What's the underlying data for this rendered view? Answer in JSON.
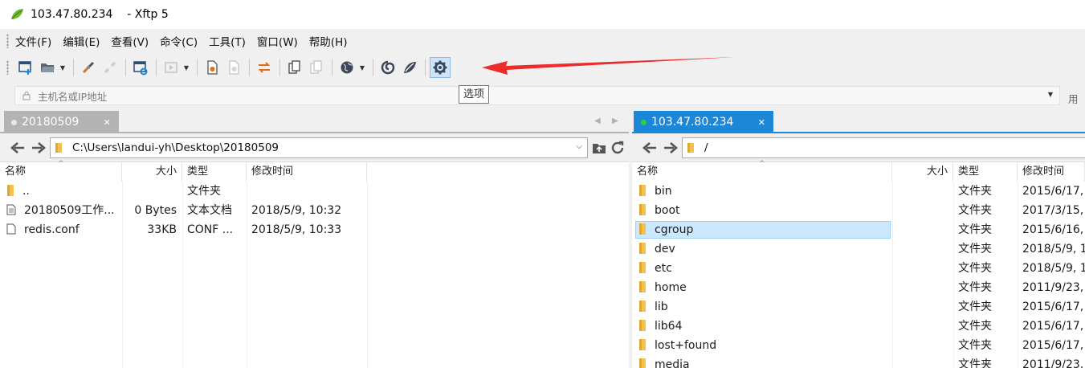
{
  "window": {
    "title": "103.47.80.234    - Xftp 5",
    "accent": "#1c86d8"
  },
  "menu": [
    "文件(F)",
    "编辑(E)",
    "查看(V)",
    "命令(C)",
    "工具(T)",
    "窗口(W)",
    "帮助(H)"
  ],
  "toolbar": {
    "buttons": [
      "new-session-icon",
      "open-folder-icon",
      "connect-icon",
      "disconnect-icon",
      "session-properties-icon",
      "transfer-icon",
      "new-file-icon",
      "new-file-disabled-icon",
      "sync-icon",
      "copy-icon",
      "paste-icon",
      "globe-icon",
      "xshell-icon",
      "xftp-icon",
      "gear-icon"
    ],
    "active": "gear-icon",
    "tooltip": "选项"
  },
  "address": {
    "host_placeholder": "主机名或IP地址",
    "user_label": "用户"
  },
  "left": {
    "tab_label": "20180509",
    "path": "C:\\Users\\landui-yh\\Desktop\\20180509",
    "columns": {
      "name": "名称",
      "size": "大小",
      "type": "类型",
      "modified": "修改时间"
    },
    "files": [
      {
        "name": "..",
        "size": "",
        "type": "文件夹",
        "modified": "",
        "icon": "folder-icon"
      },
      {
        "name": "20180509工作...",
        "size": "0 Bytes",
        "type": "文本文档",
        "modified": "2018/5/9, 10:32",
        "icon": "text-file-icon"
      },
      {
        "name": "redis.conf",
        "size": "33KB",
        "type": "CONF ...",
        "modified": "2018/5/9, 10:33",
        "icon": "file-icon"
      }
    ]
  },
  "right": {
    "tab_label": "103.47.80.234",
    "path": "/",
    "columns": {
      "name": "名称",
      "size": "大小",
      "type": "类型",
      "modified": "修改时间"
    },
    "selected_index": 2,
    "files": [
      {
        "name": "bin",
        "size": "",
        "type": "文件夹",
        "modified": "2015/6/17,"
      },
      {
        "name": "boot",
        "size": "",
        "type": "文件夹",
        "modified": "2017/3/15,"
      },
      {
        "name": "cgroup",
        "size": "",
        "type": "文件夹",
        "modified": "2015/6/16,"
      },
      {
        "name": "dev",
        "size": "",
        "type": "文件夹",
        "modified": "2018/5/9, 1"
      },
      {
        "name": "etc",
        "size": "",
        "type": "文件夹",
        "modified": "2018/5/9, 1"
      },
      {
        "name": "home",
        "size": "",
        "type": "文件夹",
        "modified": "2011/9/23,"
      },
      {
        "name": "lib",
        "size": "",
        "type": "文件夹",
        "modified": "2015/6/17,"
      },
      {
        "name": "lib64",
        "size": "",
        "type": "文件夹",
        "modified": "2015/6/17,"
      },
      {
        "name": "lost+found",
        "size": "",
        "type": "文件夹",
        "modified": "2015/6/17,"
      },
      {
        "name": "media",
        "size": "",
        "type": "文件夹",
        "modified": "2011/9/23,"
      }
    ]
  }
}
